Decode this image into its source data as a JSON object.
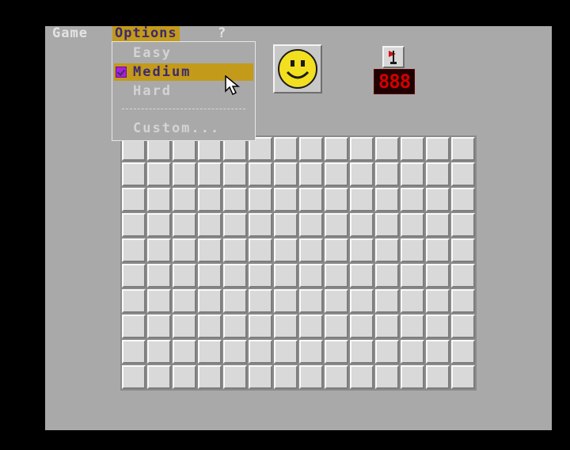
{
  "menubar": {
    "game_label": "Game",
    "options_label": "Options",
    "help_label": "?"
  },
  "options_menu": {
    "items": [
      {
        "label": "Easy",
        "checked": false
      },
      {
        "label": "Medium",
        "checked": true
      },
      {
        "label": "Hard",
        "checked": false
      },
      {
        "label": "Custom...",
        "checked": false
      }
    ]
  },
  "status": {
    "face_icon": "smiley-icon",
    "flag_icon": "flag-icon",
    "mine_counter": "888"
  },
  "board": {
    "columns": 14,
    "rows": 10,
    "cell_state": "unrevealed"
  },
  "colors": {
    "background": "#a9a9a9",
    "highlight": "#c39a1a",
    "highlight_text": "#3b2a6e",
    "counter_digits": "#d40000",
    "checkbox": "#a81fd8"
  }
}
